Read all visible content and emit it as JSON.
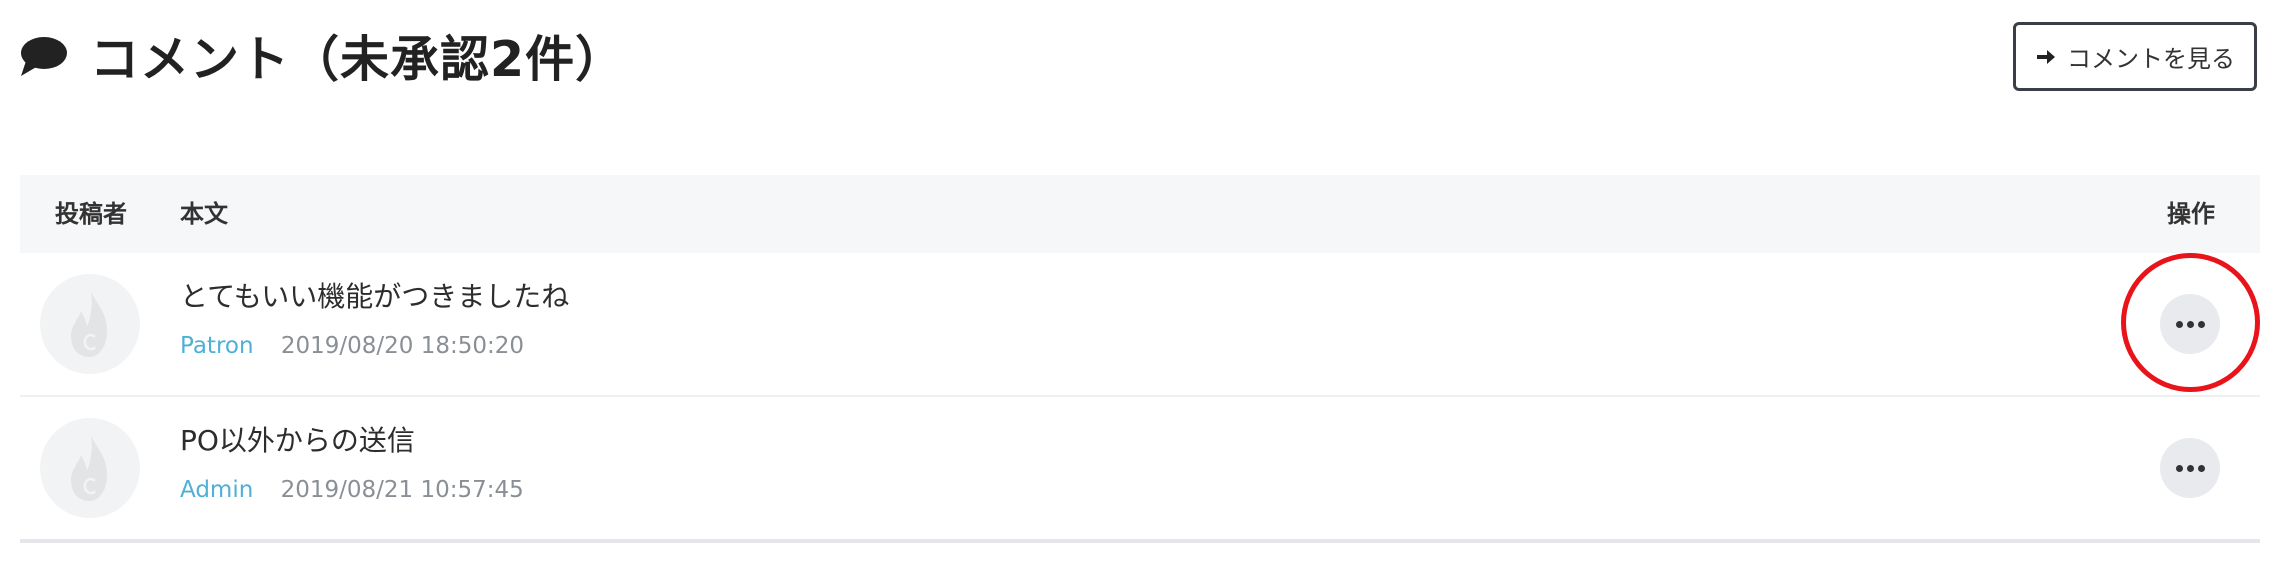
{
  "header": {
    "title": "コメント（未承認2件）",
    "icon": "speech-bubble-icon",
    "view_button": {
      "label": "コメントを見る",
      "icon": "arrow-right-icon"
    }
  },
  "table": {
    "columns": {
      "author": "投稿者",
      "body": "本文",
      "actions": "操作"
    },
    "rows": [
      {
        "avatar_icon": "flame-avatar-icon",
        "body": "とてもいい機能がつきましたね",
        "user": "Patron",
        "date": "2019/08/20 18:50:20",
        "more_icon": "more-dots-icon"
      },
      {
        "avatar_icon": "flame-avatar-icon",
        "body": "PO以外からの送信",
        "user": "Admin",
        "date": "2019/08/21 10:57:45",
        "more_icon": "more-dots-icon"
      }
    ]
  },
  "colors": {
    "link": "#4fb0d6",
    "highlight": "#e8141a",
    "header_bg": "#f6f7f9"
  }
}
